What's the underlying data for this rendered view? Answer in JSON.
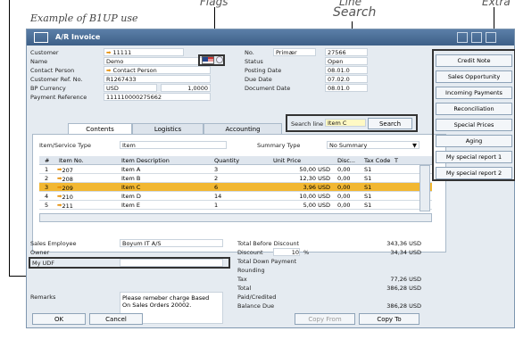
{
  "annotations": {
    "caption": "Example of B1UP use",
    "flags": "Flags",
    "line_search_1": "Line",
    "line_search_2": "Search",
    "extra_buttons": "Extra"
  },
  "window": {
    "title": "A/R Invoice"
  },
  "header": {
    "left": [
      {
        "label": "Customer",
        "value": "11111"
      },
      {
        "label": "Name",
        "value": "Demo"
      },
      {
        "label": "Contact Person",
        "value": "Contact Person"
      },
      {
        "label": "Customer Ref. No.",
        "value": "R1267433"
      },
      {
        "label": "BP Currency",
        "value": "USD",
        "extra": "1,0000"
      },
      {
        "label": "Payment Reference",
        "value": "111110000275662"
      }
    ],
    "right": [
      {
        "label": "No.",
        "series": "Primær",
        "value": "27566"
      },
      {
        "label": "Status",
        "value": "Open"
      },
      {
        "label": "Posting Date",
        "value": "08.01.0"
      },
      {
        "label": "Due Date",
        "value": "07.02.0"
      },
      {
        "label": "Document Date",
        "value": "08.01.0"
      }
    ]
  },
  "tabs": [
    "Contents",
    "Logistics",
    "Accounting"
  ],
  "search": {
    "label": "Search line",
    "value": "Item C",
    "button": "Search"
  },
  "contents": {
    "item_service_type_label": "Item/Service Type",
    "item_service_type_value": "Item",
    "summary_type_label": "Summary Type",
    "summary_type_value": "No Summary",
    "columns": [
      "#",
      "Item No.",
      "Item Description",
      "Quantity",
      "Unit Price",
      "Disc...",
      "Tax Code",
      "T"
    ],
    "rows": [
      {
        "num": "1",
        "item_no": "207",
        "desc": "Item A",
        "qty": "3",
        "price": "50,00 USD",
        "disc": "0,00",
        "tax": "S1"
      },
      {
        "num": "2",
        "item_no": "208",
        "desc": "Item B",
        "qty": "2",
        "price": "12,30 USD",
        "disc": "0,00",
        "tax": "S1"
      },
      {
        "num": "3",
        "item_no": "209",
        "desc": "Item C",
        "qty": "6",
        "price": "3,96 USD",
        "disc": "0,00",
        "tax": "S1"
      },
      {
        "num": "4",
        "item_no": "210",
        "desc": "Item D",
        "qty": "14",
        "price": "10,00 USD",
        "disc": "0,00",
        "tax": "S1"
      },
      {
        "num": "5",
        "item_no": "211",
        "desc": "Item E",
        "qty": "1",
        "price": "5,00 USD",
        "disc": "0,00",
        "tax": "S1"
      }
    ]
  },
  "footer_left": {
    "sales_employee_label": "Sales Employee",
    "sales_employee_value": "Boyum IT A/S",
    "owner_label": "Owner",
    "udf_label": "My UDF",
    "remarks_label": "Remarks",
    "remarks_value_1": "Please remeber charge Based",
    "remarks_value_2": "On Sales Orders 20002."
  },
  "totals": [
    {
      "label": "Total Before Discount",
      "value": "343,36 USD"
    },
    {
      "label": "Discount",
      "pct": "10",
      "pct_sign": "%",
      "value": "34,34 USD"
    },
    {
      "label": "Total Down Payment",
      "value": ""
    },
    {
      "label": "Rounding",
      "value": ""
    },
    {
      "label": "Tax",
      "value": "77,26 USD"
    },
    {
      "label": "Total",
      "value": "386,28 USD"
    },
    {
      "label": "Paid/Credited",
      "value": ""
    },
    {
      "label": "Balance Due",
      "value": "386,28 USD"
    }
  ],
  "buttons": {
    "ok": "OK",
    "cancel": "Cancel",
    "copy_from": "Copy From",
    "copy_to": "Copy To"
  },
  "extra_buttons": [
    "Credit Note",
    "Sales Opportunity",
    "Incoming Payments",
    "Reconciliation",
    "Special Prices",
    "Aging",
    "My special report 1",
    "My special report 2"
  ],
  "colors": {
    "selected_row": "#f2b731",
    "arrow": "#e58b00",
    "titlebar": "#4a6d96"
  }
}
